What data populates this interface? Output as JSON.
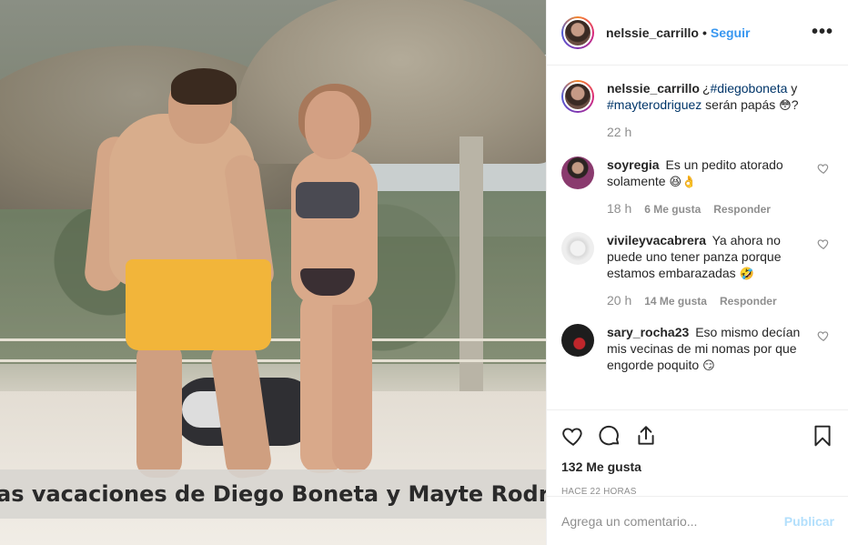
{
  "photo": {
    "overlay_text": "as vacaciones de Diego Boneta y Mayte Rodríg"
  },
  "header": {
    "username": "nelssie_carrillo",
    "separator": "•",
    "follow_label": "Seguir",
    "more_label": "•••"
  },
  "caption": {
    "username": "nelssie_carrillo",
    "prefix": "¿",
    "hashtag1": "#diegoboneta",
    "connector": " y ",
    "hashtag2": "#mayterodriguez",
    "text": " serán papás ",
    "emoji": "😳",
    "suffix": "?",
    "time": "22 h"
  },
  "comments": [
    {
      "username": "soyregia",
      "text": "Es un pedito atorado solamente ",
      "emoji": "😆👌",
      "time": "18 h",
      "likes": "6 Me gusta",
      "reply": "Responder"
    },
    {
      "username": "vivileyvacabrera",
      "text": "Ya ahora no puede uno tener panza porque estamos embarazadas ",
      "emoji": "🤣",
      "time": "20 h",
      "likes": "14 Me gusta",
      "reply": "Responder"
    },
    {
      "username": "sary_rocha23",
      "text": "Eso mismo decían mis vecinas de mi nomas por que engorde poquito ",
      "emoji": "😏"
    }
  ],
  "post": {
    "likes": "132 Me gusta",
    "time_ago": "HACE 22 HORAS"
  },
  "add_comment": {
    "placeholder": "Agrega un comentario...",
    "publish_label": "Publicar"
  },
  "colors": {
    "link_blue": "#3897f0",
    "hashtag": "#003569",
    "muted": "#8e8e8e",
    "publish_disabled": "#b2dffc"
  }
}
